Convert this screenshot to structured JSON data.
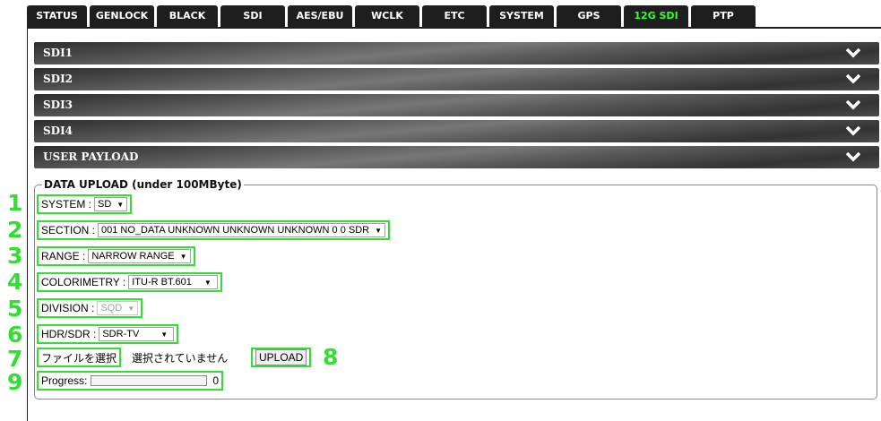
{
  "tabs": [
    {
      "label": "STATUS",
      "active": false
    },
    {
      "label": "GENLOCK",
      "active": false
    },
    {
      "label": "BLACK",
      "active": false
    },
    {
      "label": "SDI",
      "active": false
    },
    {
      "label": "AES/EBU",
      "active": false
    },
    {
      "label": "WCLK",
      "active": false
    },
    {
      "label": "ETC",
      "active": false
    },
    {
      "label": "SYSTEM",
      "active": false
    },
    {
      "label": "GPS",
      "active": false
    },
    {
      "label": "12G SDI",
      "active": true
    },
    {
      "label": "PTP",
      "active": false
    }
  ],
  "sections": [
    "SDI1",
    "SDI2",
    "SDI3",
    "SDI4",
    "USER PAYLOAD"
  ],
  "upload": {
    "legend": "DATA UPLOAD (under 100MByte)",
    "system": {
      "label": "SYSTEM :",
      "value": "SD"
    },
    "section": {
      "label": "SECTION :",
      "value": "001 NO_DATA UNKNOWN UNKNOWN UNKNOWN 0 0 SDR"
    },
    "range": {
      "label": "RANGE :",
      "value": "NARROW RANGE"
    },
    "colorimetry": {
      "label": "COLORIMETRY :",
      "value": "ITU-R BT.601"
    },
    "division": {
      "label": "DIVISION :",
      "value": "SQD",
      "disabled": true
    },
    "hdr_sdr": {
      "label": "HDR/SDR :",
      "value": "SDR-TV"
    },
    "file": {
      "button": "ファイルを選択",
      "status": "選択されていません"
    },
    "upload_button": "UPLOAD",
    "progress": {
      "label": "Progress:",
      "value": "0",
      "fraction": 0
    }
  },
  "callouts": [
    "1",
    "2",
    "3",
    "4",
    "5",
    "6",
    "7",
    "8",
    "9"
  ],
  "colors": {
    "accent": "#33dd33",
    "tab_bg": "#1e1e1e",
    "active_tab_text": "#33ff33"
  }
}
